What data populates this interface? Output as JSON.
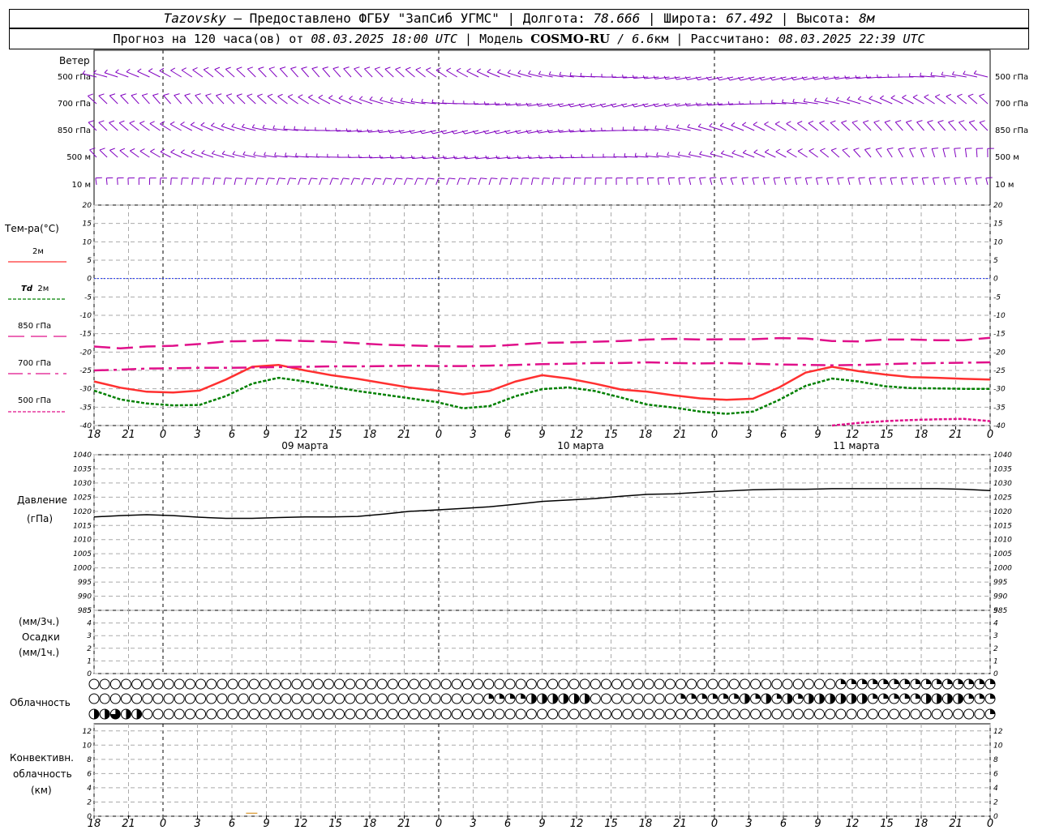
{
  "header": {
    "station": "Tazovsky",
    "dash": "–",
    "provider": "Предоставлено ФГБУ \"ЗапСиб УГМС\"",
    "lon_label": "Долгота:",
    "lon_value": "78.666",
    "lat_label": "Широта:",
    "lat_value": "67.492",
    "alt_label": "Высота:",
    "alt_value": "8м",
    "forecast_prefix": "Прогноз на 120 часа(ов) от",
    "forecast_time": "08.03.2025 18:00 UTC",
    "model_label": "Модель",
    "model_name": "COSMO-RU",
    "model_res": "/ 6.6",
    "model_res_unit": "км",
    "calc_label": "Рассчитано:",
    "calc_time": "08.03.2025 22:39 UTC"
  },
  "labels": {
    "wind_title": "Ветер",
    "wind_levels": [
      "500 гПа",
      "700 гПа",
      "850 гПа",
      "500 м",
      "10  м"
    ],
    "temp_title": "Тем-ра(°C)",
    "t2m": "2м",
    "td_prefix": "Td",
    "td_2m": "2м",
    "t850": "850 гПа",
    "t700": "700 гПа",
    "t500": "500 гПа",
    "pressure_title": "Давление",
    "pressure_unit": "(гПа)",
    "precip_unit3": "(мм/3ч.)",
    "precip_title": "Осадки",
    "precip_unit1": "(мм/1ч.)",
    "cloud_title": "Облачность",
    "conv_title1": "Конвективн.",
    "conv_title2": "облачность",
    "conv_unit": "(км)"
  },
  "colors": {
    "t2m": "#ff3030",
    "td2m": "#008000",
    "t850": "#e0108a",
    "t700": "#e0108a",
    "t500": "#e0108a",
    "wind": "#8000c0",
    "zero_line": "#1a2ff0",
    "pressure": "#000000",
    "conv": "#d08000"
  },
  "chart_data": [
    {
      "type": "line",
      "title": "Тем-ра(°C)",
      "x_ticks": [
        "18",
        "21",
        "0",
        "3",
        "6",
        "9",
        "12",
        "15",
        "18",
        "21",
        "0",
        "3",
        "6",
        "9",
        "12",
        "15",
        "18",
        "21",
        "0",
        "3",
        "6",
        "9",
        "12",
        "15",
        "18",
        "21",
        "0"
      ],
      "dates": [
        "09 марта",
        "10 марта",
        "11 марта"
      ],
      "ylim": [
        -40,
        20
      ],
      "y_ticks": [
        20,
        15,
        10,
        5,
        0,
        -5,
        -10,
        -15,
        -20,
        -25,
        -30,
        -35,
        -40
      ],
      "x_hours": [
        0,
        3,
        6,
        9,
        12,
        15,
        18,
        21,
        24,
        27,
        30,
        33,
        36,
        39,
        42,
        45,
        48,
        51,
        54,
        57,
        60,
        63,
        66,
        69,
        72,
        75,
        78
      ],
      "series": [
        {
          "name": "2м",
          "values": [
            -28,
            -29.7,
            -30.8,
            -31,
            -30.5,
            -27.5,
            -24,
            -23.5,
            -25,
            -26.3,
            -27.3,
            -28.5,
            -29.7,
            -30.5,
            -31.5,
            -30.6,
            -28,
            -26.3,
            -27.2,
            -28.6,
            -30.2,
            -30.8,
            -31.8,
            -32.6,
            -33,
            -32.7,
            -29.6,
            -25.6,
            -24,
            -25.2,
            -26.1,
            -26.8,
            -27,
            -27.3,
            -27.5
          ]
        },
        {
          "name": "Td 2м",
          "values": [
            -30.5,
            -32.9,
            -34,
            -34.5,
            -34.4,
            -32,
            -28.6,
            -27,
            -28,
            -29.4,
            -30.6,
            -31.6,
            -32.6,
            -33.6,
            -35.3,
            -34.7,
            -32,
            -30.1,
            -29.6,
            -30.6,
            -32.4,
            -34.3,
            -35.1,
            -36.2,
            -36.8,
            -36.2,
            -33,
            -29.2,
            -27.2,
            -28,
            -29.3,
            -29.8,
            -29.9,
            -30,
            -30
          ]
        },
        {
          "name": "850 гПа",
          "values": [
            -18.5,
            -19,
            -18.5,
            -18.3,
            -17.8,
            -17.1,
            -17,
            -16.8,
            -17,
            -17.2,
            -17.6,
            -18,
            -18.2,
            -18.4,
            -18.5,
            -18.4,
            -18,
            -17.5,
            -17.4,
            -17.2,
            -17,
            -16.6,
            -16.4,
            -16.6,
            -16.5,
            -16.5,
            -16.2,
            -16.3,
            -17,
            -17.1,
            -16.6,
            -16.6,
            -16.8,
            -16.8,
            -16.1
          ]
        },
        {
          "name": "700 гПа",
          "values": [
            -25,
            -24.8,
            -24.5,
            -24.4,
            -24.3,
            -24.3,
            -24.2,
            -24.1,
            -24,
            -23.9,
            -23.9,
            -23.8,
            -23.7,
            -23.8,
            -23.8,
            -23.7,
            -23.5,
            -23.3,
            -23.2,
            -23,
            -23,
            -22.8,
            -23,
            -23.1,
            -23,
            -23.2,
            -23.4,
            -23.5,
            -23.6,
            -23.5,
            -23.3,
            -23.1,
            -23,
            -22.9,
            -22.8
          ]
        },
        {
          "name": "500 гПа",
          "values": [
            null,
            null,
            null,
            null,
            null,
            null,
            null,
            null,
            null,
            null,
            null,
            null,
            null,
            null,
            null,
            null,
            null,
            null,
            null,
            null,
            null,
            null,
            null,
            null,
            null,
            null,
            null,
            null,
            -40,
            -39.3,
            -38.8,
            -38.5,
            -38.3,
            -38.2,
            -38.8
          ]
        }
      ],
      "series_x_step_hours": 3.529
    },
    {
      "type": "line",
      "title": "Давление",
      "ylabel": "(гПа)",
      "ylim": [
        985,
        1040
      ],
      "y_ticks": [
        1040,
        1035,
        1030,
        1025,
        1020,
        1015,
        1010,
        1005,
        1000,
        995,
        990,
        985
      ],
      "series": [
        {
          "name": "Давление",
          "values": [
            1018,
            1018.5,
            1018.8,
            1018.5,
            1017.9,
            1017.5,
            1017.5,
            1017.8,
            1018,
            1018,
            1018.2,
            1019,
            1020,
            1020.5,
            1021,
            1021.6,
            1022.5,
            1023.5,
            1024,
            1024.5,
            1025.3,
            1026,
            1026.2,
            1026.7,
            1027.2,
            1027.6,
            1027.8,
            1027.8,
            1028,
            1028,
            1028,
            1028,
            1028,
            1027.8,
            1027.3
          ]
        }
      ]
    },
    {
      "type": "bar",
      "title": "Осадки",
      "ylabel": "(мм/3ч.) (мм/1ч.)",
      "ylim": [
        0,
        5
      ],
      "y_ticks": [
        5,
        4,
        3,
        2,
        1,
        0
      ],
      "values": []
    },
    {
      "type": "table",
      "title": "Облачность",
      "rows": 3,
      "cells_per_row": 85,
      "cover_levels": "0=empty,1=quarter,2=half,3=three-quarter,4=full",
      "row_top": "0000000000000000000000000000000000000000000000000000000000000000000000111111111111111112222223444",
      "row_mid": "00000000000000000000000000000000000001111222222000000001111112121212222221111122221111000",
      "row_low": "2232200000000000000000000000000000000000000000000000000000000000000000000000000000001444444"
    },
    {
      "type": "bar",
      "title": "Конвективн. облачность",
      "ylabel": "(км)",
      "ylim": [
        0,
        13
      ],
      "y_ticks": [
        12,
        10,
        8,
        6,
        4,
        2,
        0
      ],
      "values": [
        {
          "hour": 21,
          "top": 0.2
        }
      ]
    }
  ],
  "wind": {
    "levels": [
      "500 гПа",
      "700 гПа",
      "850 гПа",
      "500 м",
      "10  м"
    ]
  }
}
